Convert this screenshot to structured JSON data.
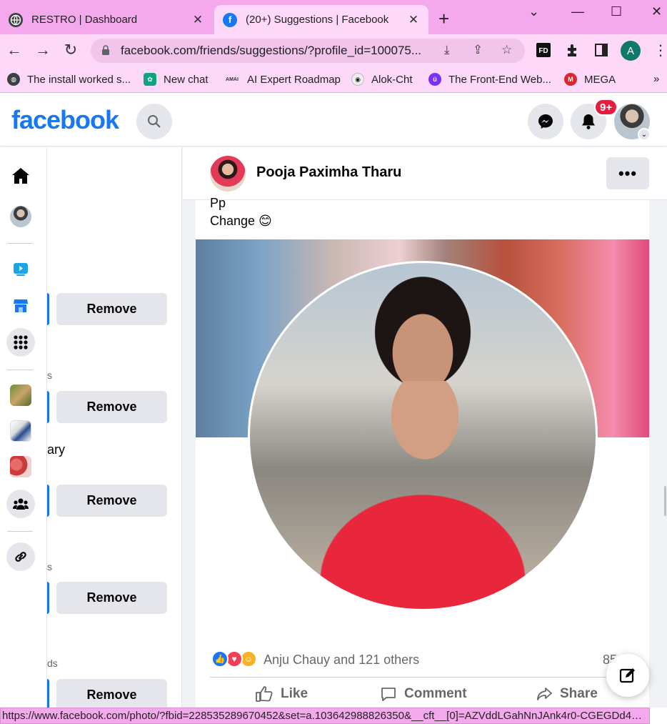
{
  "browser": {
    "tabs": [
      {
        "title": "RESTRO | Dashboard",
        "active": false
      },
      {
        "title": "(20+) Suggestions | Facebook",
        "active": true
      }
    ],
    "url": "facebook.com/friends/suggestions/?profile_id=100075...",
    "profile_initial": "A",
    "bookmarks": [
      {
        "label": "The install worked s..."
      },
      {
        "label": "New chat"
      },
      {
        "label": "AI Expert Roadmap",
        "icon_text": "AMAI"
      },
      {
        "label": "Alok-Cht"
      },
      {
        "label": "The Front-End Web..."
      },
      {
        "label": "MEGA"
      }
    ],
    "status_url": "https://www.facebook.com/photo/?fbid=228535289670452&set=a.103642988826350&__cft__[0]=AZVddLGahNnJAnk4r0-CGEGDd4X-e..."
  },
  "facebook": {
    "logo": "facebook",
    "notification_badge": "9+",
    "accent": "#1877f2"
  },
  "suggestions": {
    "remove_label": "Remove",
    "fragments": [
      "s",
      "ary",
      "s",
      "ds"
    ]
  },
  "post": {
    "author": "Pooja Paximha Tharu",
    "more_label": "•••",
    "caption_line1": "Pp",
    "caption_line2": "Change 😊",
    "reactions_text": "Anju Chauy and 121 others",
    "comment_count": "85",
    "actions": {
      "like": "Like",
      "comment": "Comment",
      "share": "Share"
    }
  }
}
